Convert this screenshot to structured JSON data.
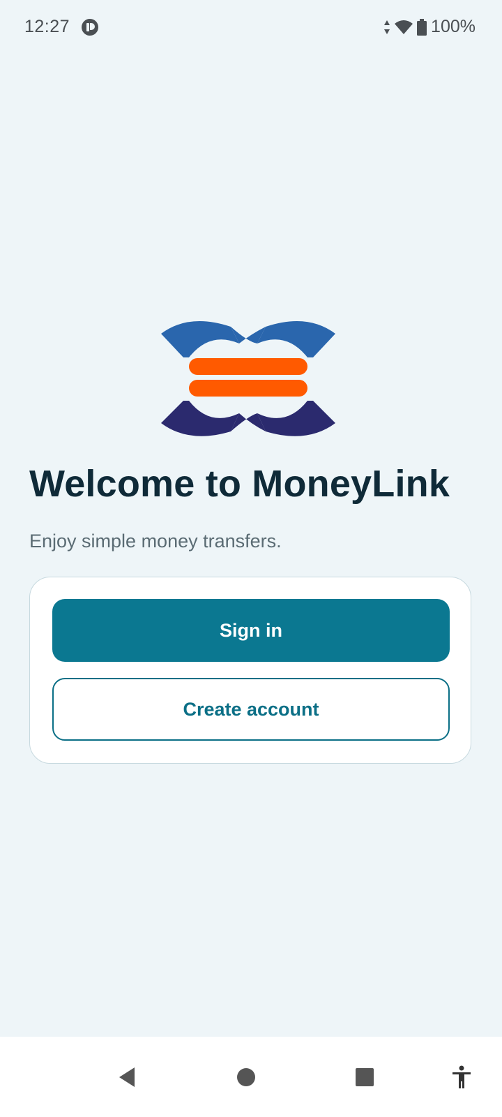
{
  "status_bar": {
    "time": "12:27",
    "battery_percent": "100%",
    "icons": [
      "app-notification-icon",
      "data-arrows-icon",
      "wifi-icon",
      "battery-icon"
    ]
  },
  "brand": {
    "logo_name": "moneylink-logo",
    "colors": {
      "blue_top": "#2a66ad",
      "blue_bottom": "#2b2a6e",
      "orange": "#ff5a00"
    }
  },
  "welcome": {
    "title": "Welcome to MoneyLink",
    "subtitle": "Enjoy simple money transfers."
  },
  "actions": {
    "sign_in_label": "Sign in",
    "create_account_label": "Create account",
    "primary_color": "#0b7891"
  },
  "nav_bar": {
    "icons": [
      "back-icon",
      "home-icon",
      "recents-icon",
      "accessibility-icon"
    ]
  }
}
